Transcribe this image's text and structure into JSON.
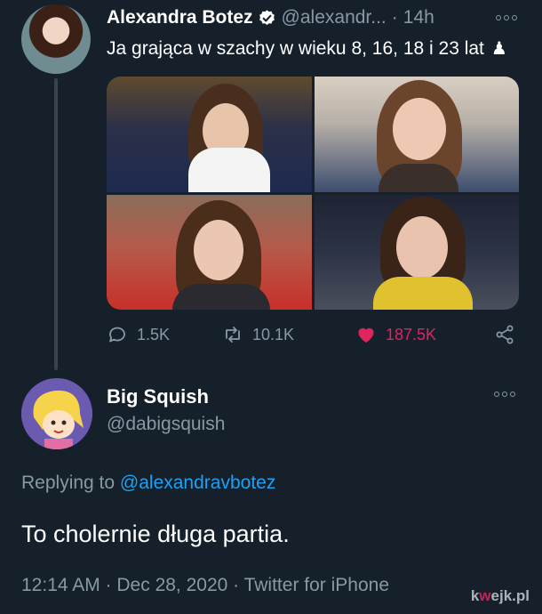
{
  "tweet": {
    "author": {
      "name": "Alexandra Botez",
      "handle": "@alexandr...",
      "time": "14h"
    },
    "text": "Ja grająca w szachy w wieku 8, 16, 18 i 23 lat",
    "emoji": "♟",
    "media": [
      "photo-1",
      "photo-2",
      "photo-3",
      "photo-4"
    ],
    "stats": {
      "replies": "1.5K",
      "retweets": "10.1K",
      "likes": "187.5K"
    }
  },
  "reply": {
    "author": {
      "name": "Big Squish",
      "handle": "@dabigsquish"
    },
    "replying_prefix": "Replying to",
    "replying_to": "@alexandravbotez",
    "text": "To cholernie długa partia.",
    "timestamp": "12:14 AM · Dec 28, 2020 · Twitter for iPhone"
  },
  "watermark": {
    "prefix": "k",
    "accent": "w",
    "suffix": "ejk.pl"
  },
  "colors": {
    "background": "#15202b",
    "muted": "#8899a6",
    "link": "#1da1f2",
    "like": "#e0245e"
  },
  "icons": [
    "verified-icon",
    "more-icon",
    "reply-icon",
    "retweet-icon",
    "heart-icon",
    "share-icon"
  ]
}
